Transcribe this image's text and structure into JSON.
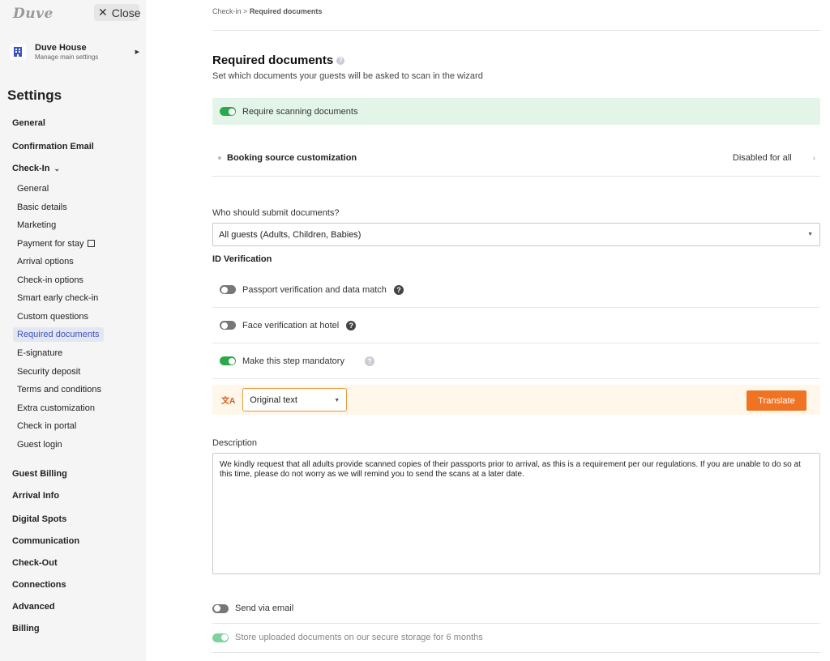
{
  "sidebar": {
    "logo": "Duve",
    "close_label": "Close",
    "property": {
      "name": "Duve House",
      "subtitle": "Manage main settings"
    },
    "settings_title": "Settings",
    "nav": {
      "general": "General",
      "confirmation_email": "Confirmation Email",
      "check_in": "Check-In",
      "guest_billing": "Guest Billing",
      "arrival_info": "Arrival Info",
      "digital_spots": "Digital Spots",
      "communication": "Communication",
      "check_out": "Check-Out",
      "connections": "Connections",
      "advanced": "Advanced",
      "billing": "Billing"
    },
    "checkin_items": [
      "General",
      "Basic details",
      "Marketing",
      "Payment for stay",
      "Arrival options",
      "Check-in options",
      "Smart early check-in",
      "Custom questions",
      "Required documents",
      "E-signature",
      "Security deposit",
      "Terms and conditions",
      "Extra customization",
      "Check in portal",
      "Guest login"
    ],
    "active_item": "Required documents"
  },
  "main": {
    "breadcrumb": {
      "parent": "Check-in",
      "separator": ">",
      "current": "Required documents"
    },
    "title": "Required documents",
    "subtitle": "Set which documents your guests will be asked to scan in the wizard",
    "require_scanning": {
      "label": "Require scanning documents",
      "on": true
    },
    "booking_source": {
      "label": "Booking source customization",
      "value": "Disabled for all"
    },
    "who_label": "Who should submit documents?",
    "who_value": "All guests (Adults, Children, Babies)",
    "id_verification_title": "ID Verification",
    "options": [
      {
        "label": "Passport verification and data match",
        "on": false
      },
      {
        "label": "Face verification at hotel",
        "on": false
      },
      {
        "label": "Make this step mandatory",
        "on": true
      }
    ],
    "translate": {
      "select_value": "Original text",
      "button": "Translate"
    },
    "description_label": "Description",
    "description_text": "We kindly request that all adults provide scanned copies of their passports prior to arrival, as this is a requirement per our regulations. If you are unable to do so at this time, please do not worry as we will remind you to send the scans at a later date.",
    "send_email": {
      "label": "Send via email",
      "on": false
    },
    "store_docs": {
      "label": "Store uploaded documents on our secure storage for 6 months",
      "on": true
    }
  },
  "colors": {
    "accent_green": "#2aa84a",
    "active_blue": "#3d55b8",
    "translate_orange": "#f07323"
  }
}
